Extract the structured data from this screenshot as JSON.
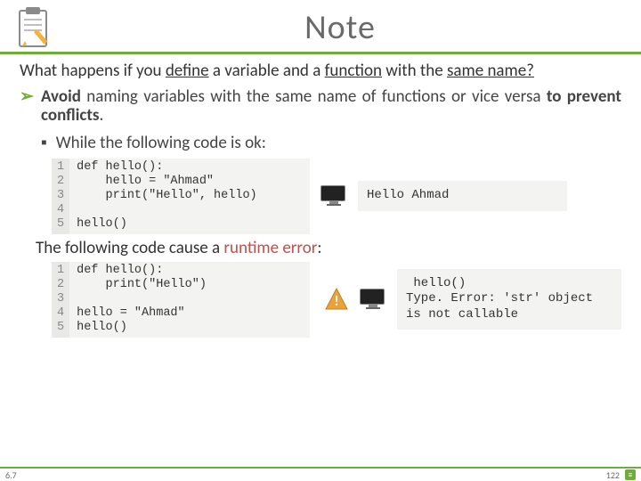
{
  "title": "Note",
  "question_pre": "What happens if you ",
  "question_mid1": "define",
  "question_mid2": " a variable and a ",
  "question_mid3": "function",
  "question_mid4": " with the ",
  "question_end": "same name?",
  "avoid_pre": "Avoid",
  "avoid_body": " naming variables with the same name of functions or vice versa ",
  "avoid_bold2": "to prevent conflicts",
  "avoid_dot": ".",
  "while_line": "While the following code is ok:",
  "code1_lines": "1\n2\n3\n4\n5",
  "code1": "def hello():\n    hello = \"Ahmad\"\n    print(\"Hello\", hello)\n\nhello()",
  "output1": "Hello Ahmad",
  "between_pre": "The following code cause a ",
  "between_err": "runtime error",
  "between_post": ":",
  "code2_lines": "1\n2\n3\n4\n5",
  "code2": "def hello():\n    print(\"Hello\")\n\nhello = \"Ahmad\"\nhello()",
  "output2": " hello()\nType. Error: 'str' object is not callable",
  "footer_left": "6.7",
  "footer_page": "122"
}
